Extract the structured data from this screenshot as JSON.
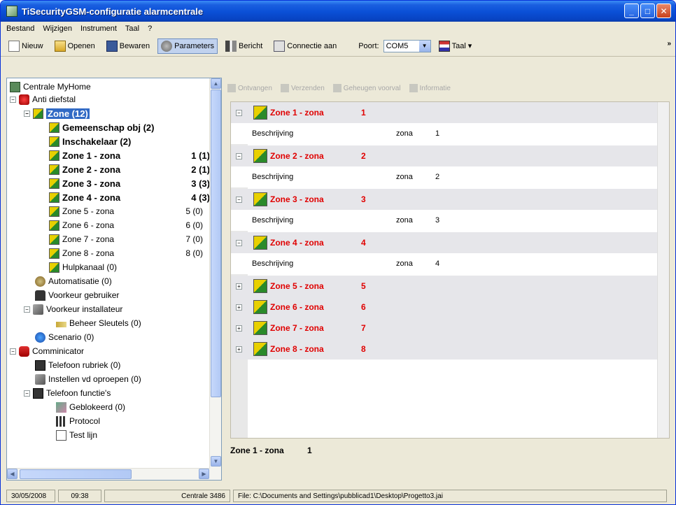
{
  "window": {
    "title": "TiSecurityGSM-configuratie alarmcentrale"
  },
  "menu": [
    "Bestand",
    "Wijzigen",
    "Instrument",
    "Taal",
    "?"
  ],
  "toolbar": {
    "new": "Nieuw",
    "open": "Openen",
    "save": "Bewaren",
    "parameters": "Parameters",
    "message": "Bericht",
    "connect": "Connectie aan",
    "port_label": "Poort:",
    "port_value": "COM5",
    "language": "Taal",
    "more": "»"
  },
  "tree": {
    "root": "Centrale MyHome",
    "anti": "Anti diefstal",
    "zone": "Zone (12)",
    "gem": "Gemeenschap obj (2)",
    "insch": "Inschakelaar (2)",
    "zones": [
      {
        "name": "Zone 1 - zona",
        "count": "1 (1)"
      },
      {
        "name": "Zone 2 - zona",
        "count": "2 (1)"
      },
      {
        "name": "Zone 3 - zona",
        "count": "3 (3)"
      },
      {
        "name": "Zone 4 - zona",
        "count": "4 (3)"
      },
      {
        "name": "Zone 5 - zona",
        "count": "5 (0)"
      },
      {
        "name": "Zone 6 - zona",
        "count": "6 (0)"
      },
      {
        "name": "Zone 7 - zona",
        "count": "7 (0)"
      },
      {
        "name": "Zone 8 - zona",
        "count": "8 (0)"
      }
    ],
    "hulp": "Hulpkanaal (0)",
    "auto": "Automatisatie (0)",
    "vgebr": "Voorkeur gebruiker",
    "vinst": "Voorkeur installateur",
    "beheer": "Beheer Sleutels (0)",
    "scen": "Scenario (0)",
    "comm": "Comminicator",
    "telrub": "Telefoon rubriek (0)",
    "instvd": "Instellen vd oproepen (0)",
    "telf": "Telefoon functie's",
    "gebl": "Geblokeerd (0)",
    "proto": "Protocol",
    "test": "Test lijn"
  },
  "right_toolbar": [
    "Ontvangen",
    "Verzenden",
    "Geheugen voorval",
    "Informatie"
  ],
  "grid": {
    "desc_label": "Beschrijving",
    "desc_value": "zona",
    "zones": [
      {
        "name": "Zone 1 - zona",
        "num": "1"
      },
      {
        "name": "Zone 2 - zona",
        "num": "2"
      },
      {
        "name": "Zone 3 - zona",
        "num": "3"
      },
      {
        "name": "Zone 4 - zona",
        "num": "4"
      },
      {
        "name": "Zone 5 - zona",
        "num": "5"
      },
      {
        "name": "Zone 6 - zona",
        "num": "6"
      },
      {
        "name": "Zone 7 - zona",
        "num": "7"
      },
      {
        "name": "Zone 8 - zona",
        "num": "8"
      }
    ]
  },
  "info": {
    "name": "Zone 1 - zona",
    "num": "1"
  },
  "status": {
    "date": "30/05/2008",
    "time": "09:38",
    "central": "Centrale 3486",
    "file": "File: C:\\Documents and Settings\\pubblicad1\\Desktop\\Progetto3.jai"
  }
}
